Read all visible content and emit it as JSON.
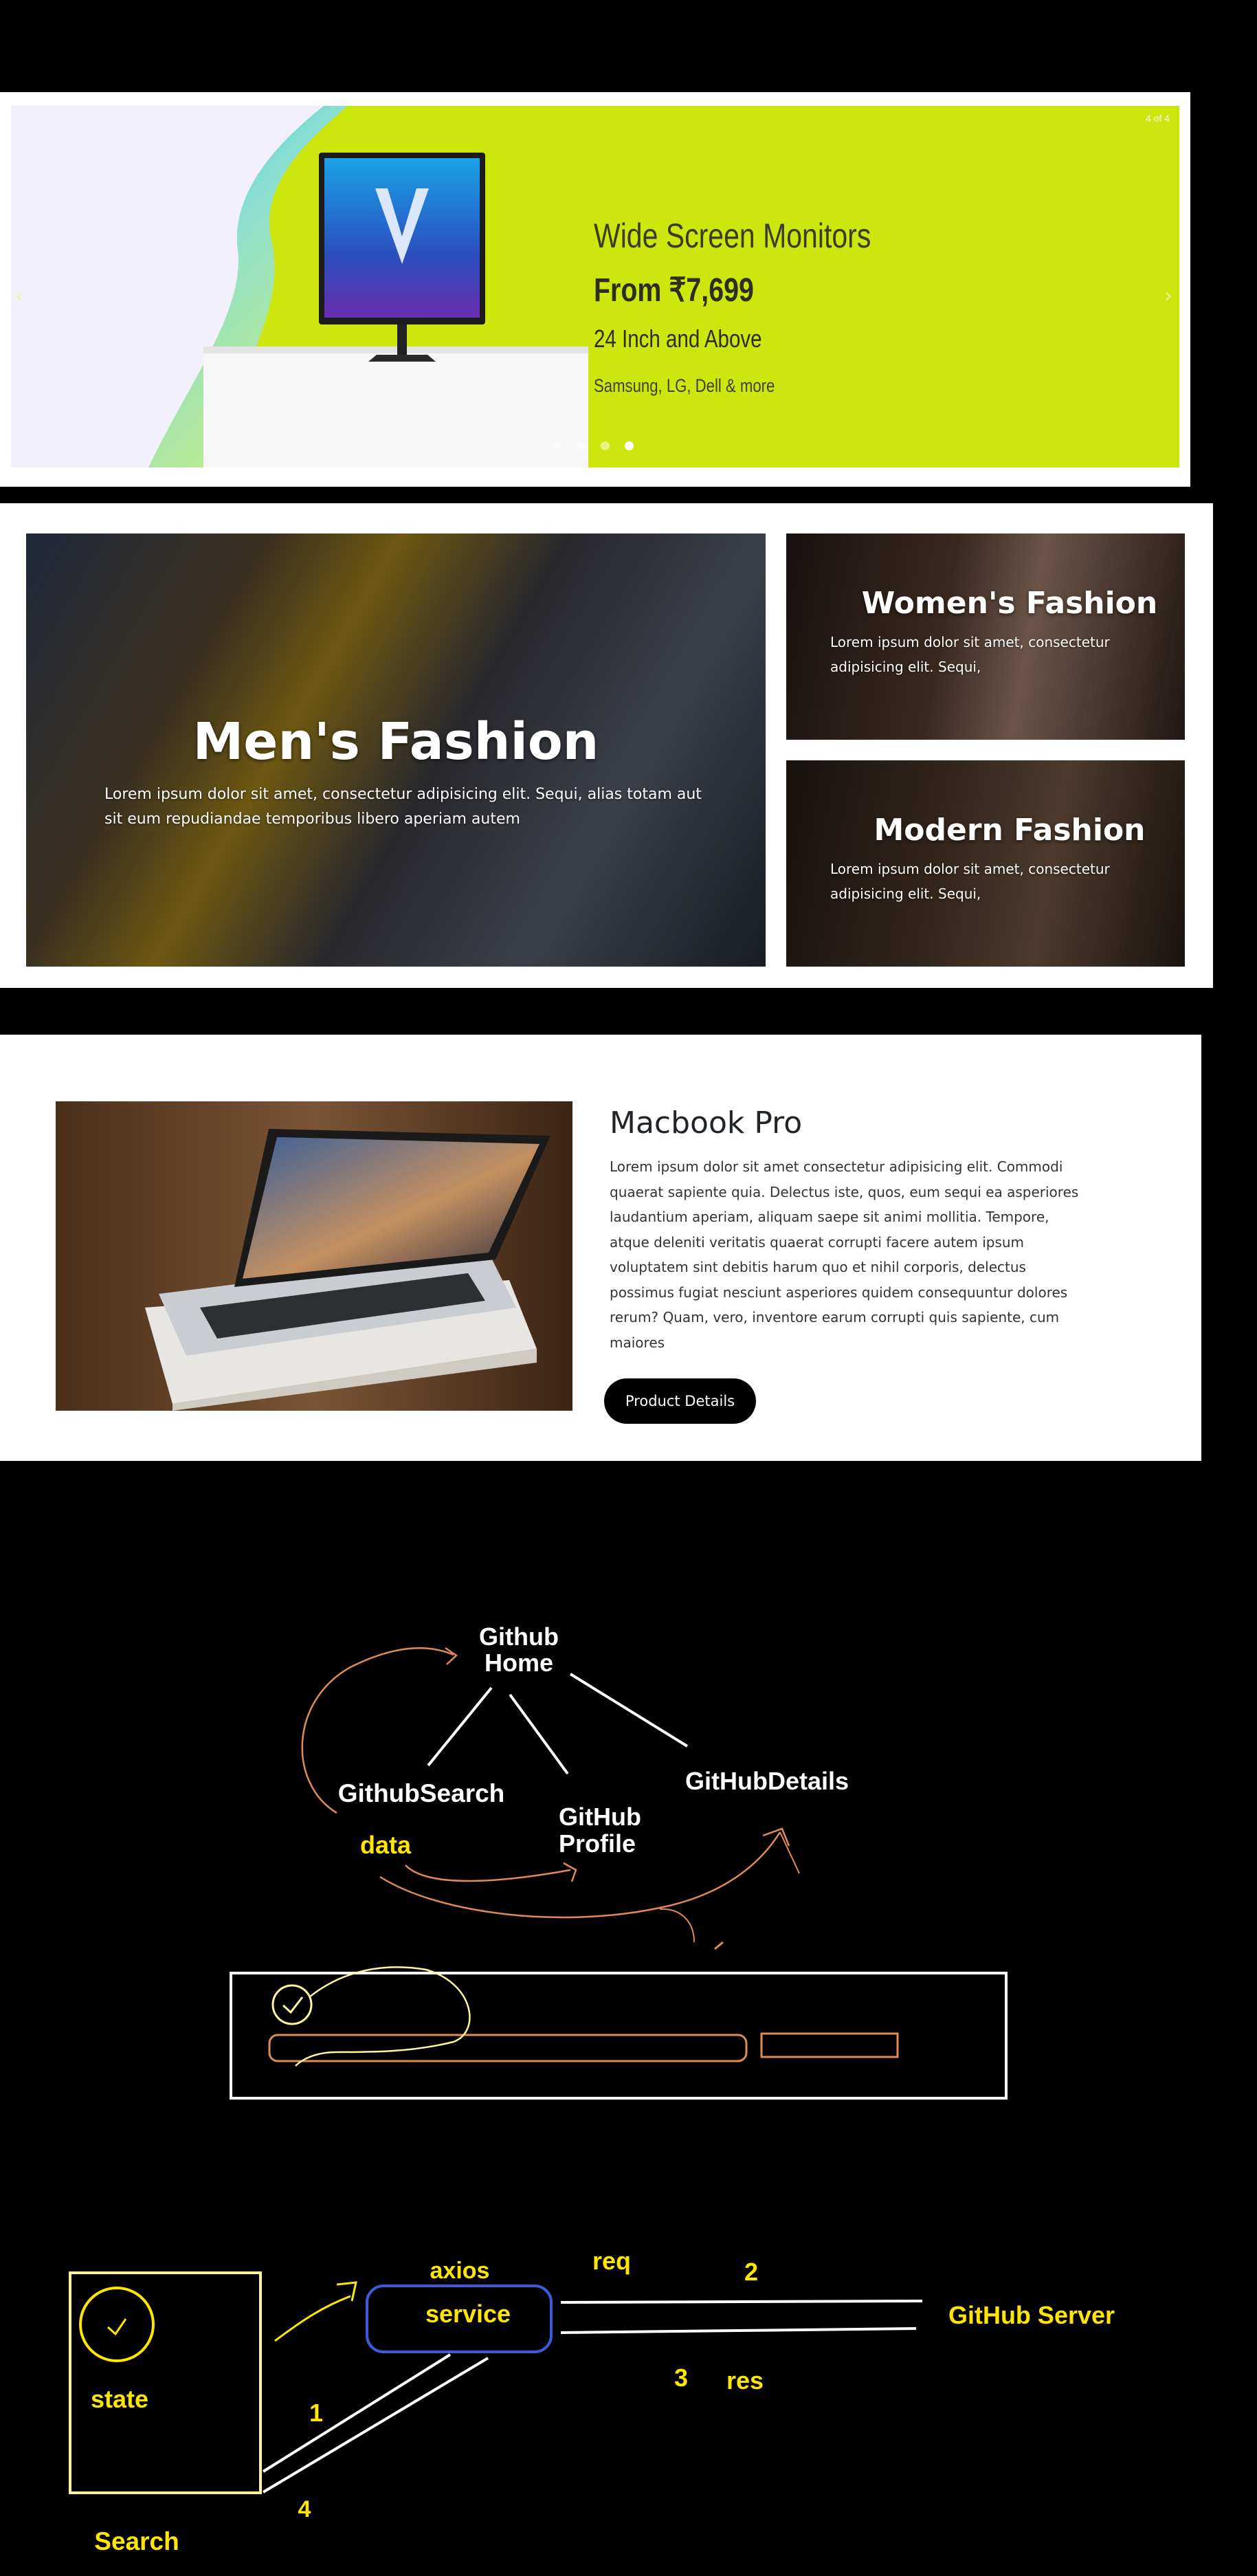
{
  "carousel": {
    "counter": "4 of 4",
    "prev_glyph": "‹",
    "next_glyph": "›",
    "slide": {
      "title": "Wide Screen Monitors",
      "price": "From ₹7,699",
      "size": "24 Inch and Above",
      "brands": "Samsung, LG, Dell & more"
    },
    "dots": 4,
    "active_dot": 4,
    "colors": {
      "slide_bg": "#cde60e"
    }
  },
  "fashion": {
    "men": {
      "title": "Men's Fashion",
      "desc": "Lorem ipsum dolor sit amet, consectetur adipisicing elit. Sequi, alias totam aut sit eum repudiandae temporibus libero aperiam autem"
    },
    "women": {
      "title": "Women's Fashion",
      "desc": "Lorem ipsum dolor sit amet, consectetur adipisicing elit. Sequi,"
    },
    "modern": {
      "title": "Modern Fashion",
      "desc": "Lorem ipsum dolor sit amet, consectetur adipisicing elit. Sequi,"
    }
  },
  "product": {
    "title": "Macbook Pro",
    "desc": "Lorem ipsum dolor sit amet consectetur adipisicing elit. Commodi quaerat sapiente quia. Delectus iste, quos, eum sequi ea asperiores laudantium aperiam, aliquam saepe sit animi mollitia. Tempore, atque deleniti veritatis quaerat corrupti facere autem ipsum voluptatem sint debitis harum quo et nihil corporis, delectus possimus fugiat nesciunt asperiores quidem consequuntur dolores rerum? Quam, vero, inventore earum corrupti quis sapiente, cum maiores",
    "button_label": "Product Details"
  },
  "diagram1": {
    "home_line1": "Github",
    "home_line2": "Home",
    "search": "GithubSearch",
    "profile_line1": "GitHub",
    "profile_line2": "Profile",
    "details": "GitHubDetails",
    "data": "data",
    "colors": {
      "text": "#ffffff",
      "accent": "#ffe600",
      "stroke": "#e08a55"
    }
  },
  "diagram2": {
    "state": "state",
    "search": "Search",
    "axios": "axios",
    "service": "service",
    "req": "req",
    "res": "res",
    "num1": "1",
    "num2": "2",
    "num3": "3",
    "num4": "4",
    "server": "GitHub Server",
    "colors": {
      "yellow": "#ffe600",
      "box": "#fff59a",
      "blue": "#3d5bd9"
    }
  }
}
